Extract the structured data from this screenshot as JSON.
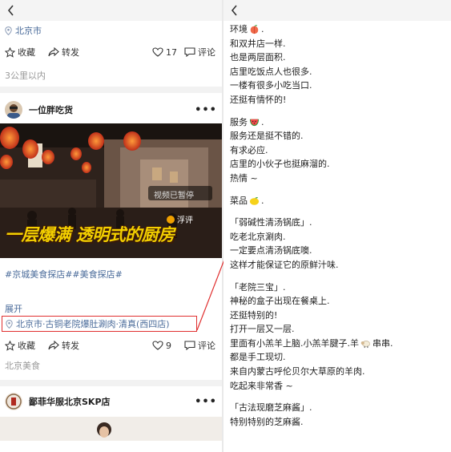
{
  "left": {
    "post1": {
      "location": "北京市",
      "actions": {
        "save": "收藏",
        "share": "转发",
        "likes": "17",
        "comment": "评论"
      },
      "distance": "3公里以内"
    },
    "post2": {
      "author": "一位胖吃货",
      "video_caption": "一层爆满 透明式的厨房",
      "paused_label": "视频已暂停",
      "float_label": "浮评",
      "tags": "#京城美食探店##美食探店#",
      "expand": "展开",
      "location": "北京市·古铜老院爆肚涮肉·清真(西四店)",
      "actions": {
        "save": "收藏",
        "share": "转发",
        "likes": "9",
        "comment": "评论"
      },
      "category": "北京美食"
    },
    "post3": {
      "author": "鄙菲华服北京SKP店"
    }
  },
  "right": {
    "lines": [
      {
        "text": "环境",
        "emoji": "peach"
      },
      {
        "text": "和双井店一样."
      },
      {
        "text": "也是两层面积."
      },
      {
        "text": "店里吃饭点人也很多."
      },
      {
        "text": "一楼有很多小吃当口."
      },
      {
        "text": "还挺有情怀的!"
      },
      {
        "gap": true
      },
      {
        "text": "服务",
        "emoji": "watermelon"
      },
      {
        "text": "服务还是挺不错的."
      },
      {
        "text": "有求必应."
      },
      {
        "text": "店里的小伙子也挺麻溜的."
      },
      {
        "text": "热情 ~"
      },
      {
        "gap": true
      },
      {
        "text": "菜品",
        "emoji": "lemon"
      },
      {
        "gap": true
      },
      {
        "text": "「弱碱性清汤锅底」."
      },
      {
        "text": "吃老北京涮肉."
      },
      {
        "text": "一定要点清汤锅底噢."
      },
      {
        "text": "这样才能保证它的原鲜汁味."
      },
      {
        "gap": true
      },
      {
        "text": "「老院三宝」."
      },
      {
        "text": "神秘的盒子出现在餐桌上."
      },
      {
        "text": "还挺特别的!"
      },
      {
        "text": "打开一层又一层."
      },
      {
        "text": "里面有小羔羊上脑.小羔羊腱子.羊",
        "emoji": "sheep",
        "after": "串串."
      },
      {
        "text": "都是手工现切."
      },
      {
        "text": "来自内蒙古呼伦贝尔大草原的羊肉."
      },
      {
        "text": "吃起来非常香 ~"
      },
      {
        "gap": true
      },
      {
        "text": "「古法现磨芝麻酱」."
      },
      {
        "text": "特别特别的芝麻酱."
      }
    ]
  },
  "colors": {
    "link": "#4a6b9a",
    "highlight": "#e03030",
    "caption": "#f4d000"
  }
}
